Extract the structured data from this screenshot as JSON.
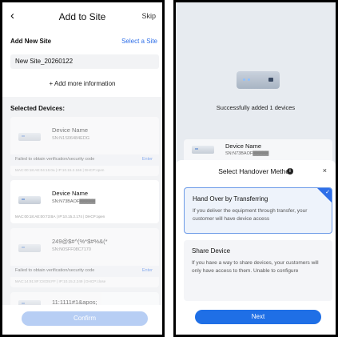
{
  "left": {
    "header": {
      "back_glyph": "‹",
      "title": "Add to Site",
      "skip": "Skip"
    },
    "new_site": {
      "label": "Add New Site",
      "select_link": "Select a Site",
      "value": "New Site_20260122",
      "add_more": "+ Add more information"
    },
    "selected_label": "Selected Devices:",
    "devices": [
      {
        "name": "Device Name",
        "sn": "SN:N1S06484EDG",
        "warn": "Failed to obtain verification/security code",
        "enter": "Enter",
        "mac": "MAC:00:18:AE:04:15:0a | IP:10.15.2.166 | DHCP:open"
      },
      {
        "name": "Device Name",
        "sn": "SN:N73BAOF▓▓▓▓▓",
        "mac": "MAC:00:18:AE:00:73:BA | IP:10.15.2.174 | DHCP:open"
      },
      {
        "name": "249@$#^(%*$#%&(*",
        "sn": "SN:N0SFF08C7170",
        "warn": "Failed to obtain verification/security code",
        "enter": "Enter",
        "mac": "MAC:14:91:8F:C8:D5:FF | IP:10.15.2.249 | DHCP:close"
      },
      {
        "name": "11:1111#1&apos;"
      }
    ],
    "confirm": "Confirm"
  },
  "right": {
    "success_text": "Successfully added 1 devices",
    "bg_device": {
      "name": "Device Name",
      "sn": "SN:N73BAOF▓▓▓▓▓"
    },
    "sheet": {
      "title": "Select Handover Method",
      "info_glyph": "i",
      "close_glyph": "×",
      "options": [
        {
          "title": "Hand Over by Transferring",
          "desc": "If you deliver the equipment through transfer, your customer will have device access",
          "selected": true
        },
        {
          "title": "Share Device",
          "desc": "If you have a way to share devices, your customers will only have access to them. Unable to configure",
          "selected": false
        }
      ],
      "next": "Next"
    }
  },
  "colors": {
    "accent": "#1f6fe6",
    "link": "#2f6fe8",
    "disabled": "#b7cef4"
  }
}
